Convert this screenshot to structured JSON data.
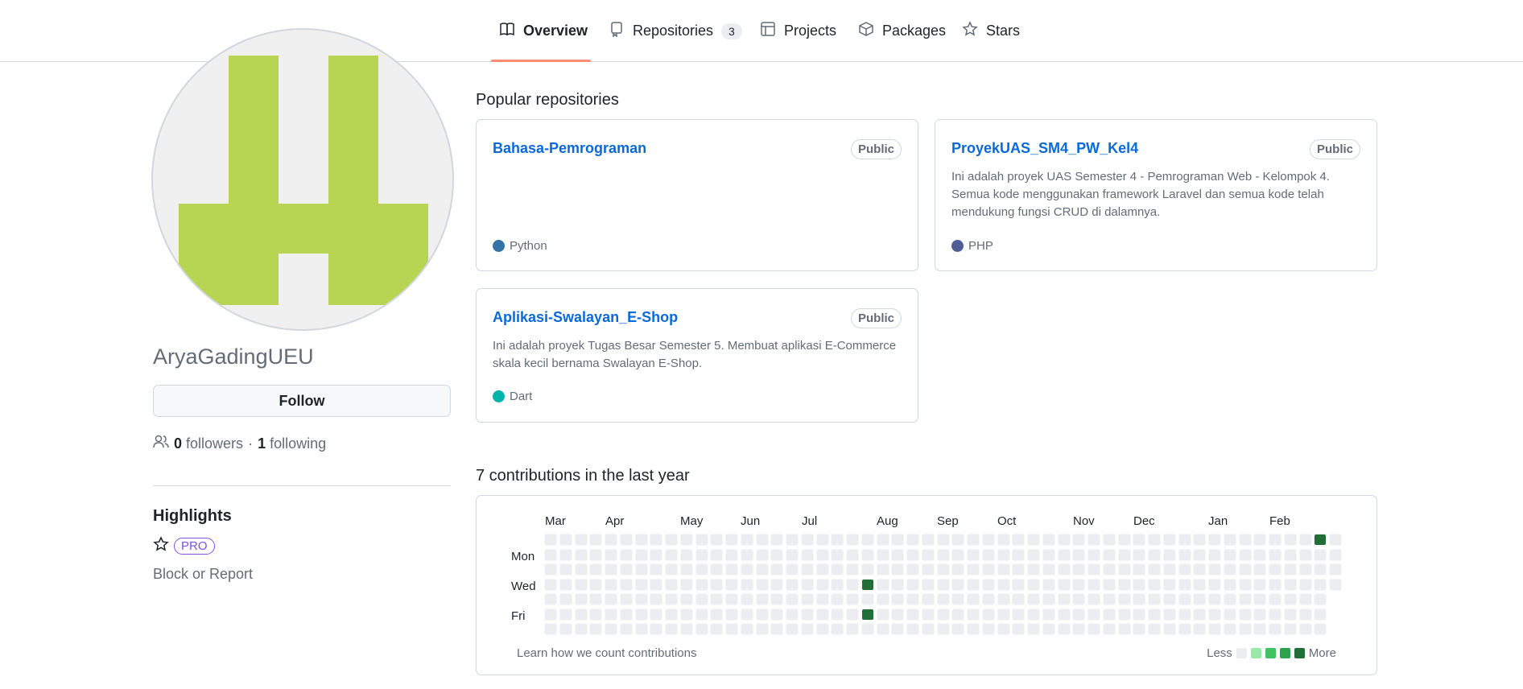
{
  "nav": {
    "tabs": [
      {
        "label": "Overview",
        "icon": "book-icon"
      },
      {
        "label": "Repositories",
        "icon": "repo-icon",
        "count": "3"
      },
      {
        "label": "Projects",
        "icon": "table-icon"
      },
      {
        "label": "Packages",
        "icon": "package-icon"
      },
      {
        "label": "Stars",
        "icon": "star-icon"
      }
    ]
  },
  "profile": {
    "username": "AryaGadingUEU",
    "follow_label": "Follow",
    "followers_count": "0",
    "followers_label": "followers",
    "separator": "·",
    "following_count": "1",
    "following_label": "following",
    "highlights_title": "Highlights",
    "pro_label": "PRO",
    "block_report": "Block or Report",
    "avatar_color": "#b7d552"
  },
  "popular": {
    "title": "Popular repositories",
    "repos": [
      {
        "name": "Bahasa-Pemrograman",
        "visibility": "Public",
        "description": "",
        "language": "Python",
        "language_color": "#3572A5"
      },
      {
        "name": "ProyekUAS_SM4_PW_Kel4",
        "visibility": "Public",
        "description": "Ini adalah proyek UAS Semester 4 - Pemrograman Web - Kelompok 4. Semua kode menggunakan framework Laravel dan semua kode telah mendukung fungsi CRUD di dalamnya.",
        "language": "PHP",
        "language_color": "#4F5D95"
      },
      {
        "name": "Aplikasi-Swalayan_E-Shop",
        "visibility": "Public",
        "description": "Ini adalah proyek Tugas Besar Semester 5. Membuat aplikasi E-Commerce skala kecil bernama Swalayan E-Shop.",
        "language": "Dart",
        "language_color": "#00B4AB"
      }
    ]
  },
  "contributions": {
    "title": "7 contributions in the last year",
    "months": [
      "Mar",
      "Apr",
      "May",
      "Jun",
      "Jul",
      "Aug",
      "Sep",
      "Oct",
      "Nov",
      "Dec",
      "Jan",
      "Feb"
    ],
    "days": [
      "Mon",
      "Wed",
      "Fri"
    ],
    "learn_label": "Learn how we count contributions",
    "legend_less": "Less",
    "legend_more": "More",
    "legend_colors": [
      "#ebedf0",
      "#9be9a8",
      "#40c463",
      "#30a14e",
      "#216e39"
    ],
    "active_cells": [
      {
        "week": 21,
        "day": 3,
        "level": 4
      },
      {
        "week": 21,
        "day": 5,
        "level": 4
      },
      {
        "week": 51,
        "day": 0,
        "level": 4
      }
    ],
    "total_weeks": 53,
    "last_week_days": 4
  }
}
